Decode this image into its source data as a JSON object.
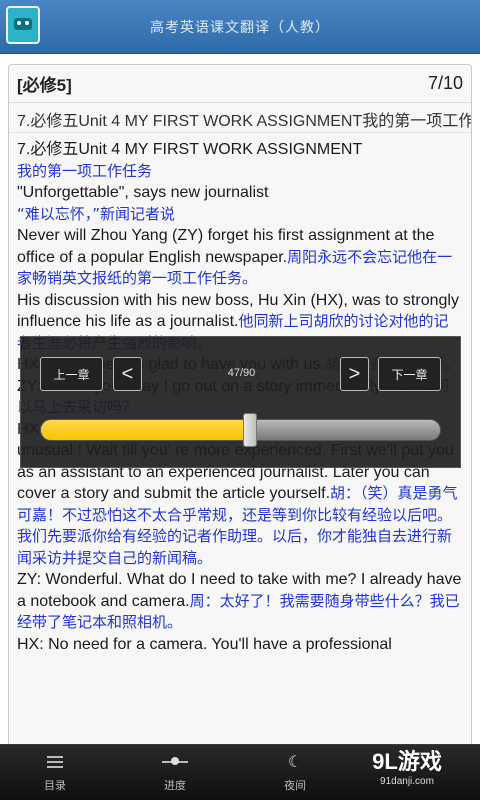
{
  "titlebar": {
    "title": "高考英语课文翻译（人教）"
  },
  "card": {
    "chapter": "[必修5]",
    "page": "7/10",
    "subtitle": "7.必修五Unit 4 MY FIRST WORK ASSIGNMENT我的第一项工作任务"
  },
  "lines": [
    {
      "t": "en",
      "s": "7.必修五Unit 4 MY FIRST WORK ASSIGNMENT"
    },
    {
      "t": "zh",
      "s": "我的第一项工作任务"
    },
    {
      "t": "en",
      "s": "\"Unforgettable\", says new journalist "
    },
    {
      "t": "zh",
      "s": "“难以忘怀，”新闻记者说"
    },
    {
      "t": "en",
      "s": "Never will Zhou Yang (ZY) forget his first assignment at the office of a popular English newspaper."
    },
    {
      "t": "zh",
      "s": "周阳永远不会忘记他在一家畅销英文报纸的第一项工作任务。"
    },
    {
      "t": "en",
      "s": " His discussion with his new boss, Hu Xin (HX), was to strongly influence his life as a journalist."
    },
    {
      "t": "zh",
      "s": "他同新上司胡欣的讨论对他的记者生涯必将产生强烈的影响。"
    },
    {
      "t": "en",
      "s": "HX: Welcome. I'm glad to have you with us."
    },
    {
      "t": "zh",
      "s": "胡：欢迎来到这里。"
    },
    {
      "t": "en",
      "s": "ZY: Thank you. May I go out on a story immediately?"
    },
    {
      "t": "zh",
      "s": "周：我可以马上去采访吗？"
    },
    {
      "t": "en",
      "s": "HX: (laughing) That' s admirable, but I' m afraid it would be unusual ! Wait till you' re more experienced. First we'll put you as an assistant to an experienced journalist. Later you can cover a story and submit the article yourself."
    },
    {
      "t": "zh",
      "s": "胡：（笑）真是勇气可嘉！不过恐怕这不太合乎常规，还是等到你比较有经验以后吧。我们先要派你给有经验的记者作助理。以后，你才能独自去进行新闻采访并提交自己的新闻稿。"
    },
    {
      "t": "en",
      "s": "ZY:  Wonderful. What do I need to take with me? I already have a notebook and camera."
    },
    {
      "t": "zh",
      "s": "周：太好了！我需要随身带些什么？我已经带了笔记本和照相机。"
    },
    {
      "t": "en",
      "s": "HX:  No need for a camera. You'll have a professional"
    }
  ],
  "overlay": {
    "prev_chapter": "上一章",
    "prev_arrow": "<",
    "next_arrow": ">",
    "next_chapter": "下一章",
    "progress_label": "47/90",
    "progress_value": 47,
    "progress_max": 90,
    "fill_color": "#f5c400"
  },
  "tabbar": {
    "tabs": [
      {
        "label": "目录",
        "icon": "list-icon"
      },
      {
        "label": "进度",
        "icon": "slider-icon"
      },
      {
        "label": "夜间",
        "icon": "moon-icon"
      }
    ]
  },
  "watermark": {
    "brand": "9L游戏",
    "url": "91danji.com"
  }
}
